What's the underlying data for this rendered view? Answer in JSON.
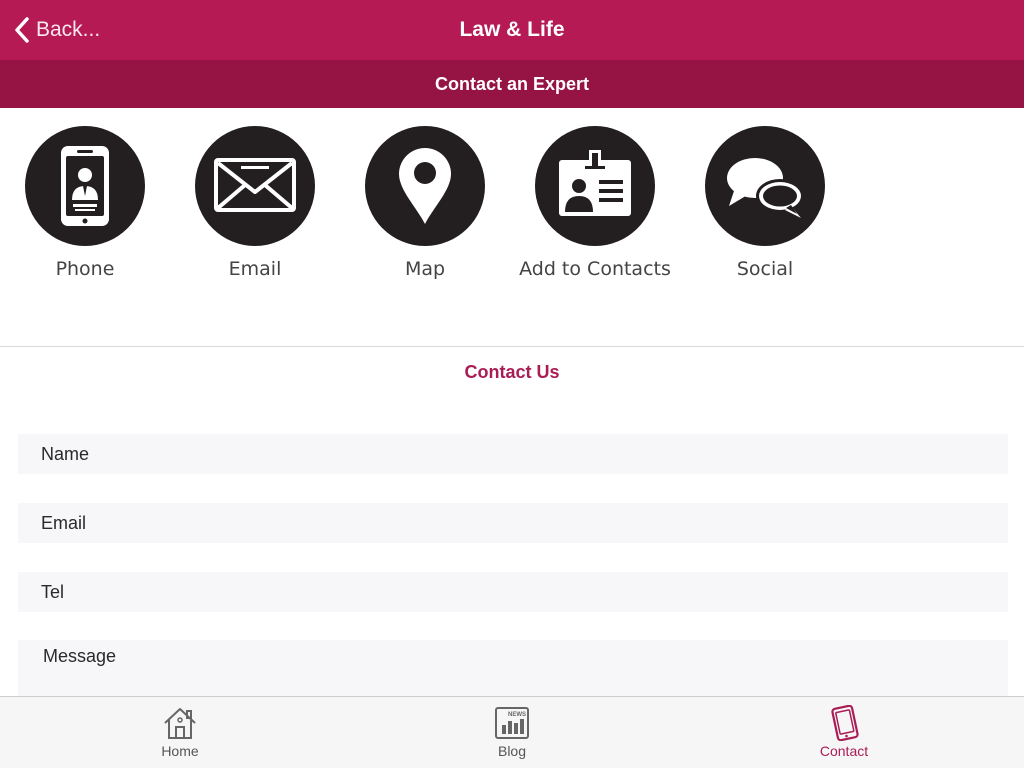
{
  "navbar": {
    "back_label": "Back...",
    "title": "Law & Life",
    "color": "#b51a54"
  },
  "subheader": {
    "title": "Contact an Expert",
    "color": "#951443"
  },
  "actions": [
    {
      "label": "Phone",
      "icon": "phone-icon"
    },
    {
      "label": "Email",
      "icon": "envelope-icon"
    },
    {
      "label": "Map",
      "icon": "map-pin-icon"
    },
    {
      "label": "Add to Contacts",
      "icon": "id-card-icon"
    },
    {
      "label": "Social",
      "icon": "chat-bubbles-icon"
    }
  ],
  "contact_form": {
    "title": "Contact Us",
    "name_placeholder": "Name",
    "email_placeholder": "Email",
    "tel_placeholder": "Tel",
    "message_placeholder": "Message"
  },
  "tabbar": {
    "tabs": [
      {
        "label": "Home",
        "icon": "home-icon",
        "active": false
      },
      {
        "label": "Blog",
        "icon": "news-icon",
        "icon_text": "NEWS",
        "active": false
      },
      {
        "label": "Contact",
        "icon": "mobile-phone-icon",
        "active": true
      }
    ],
    "active_color": "#a91d55"
  }
}
